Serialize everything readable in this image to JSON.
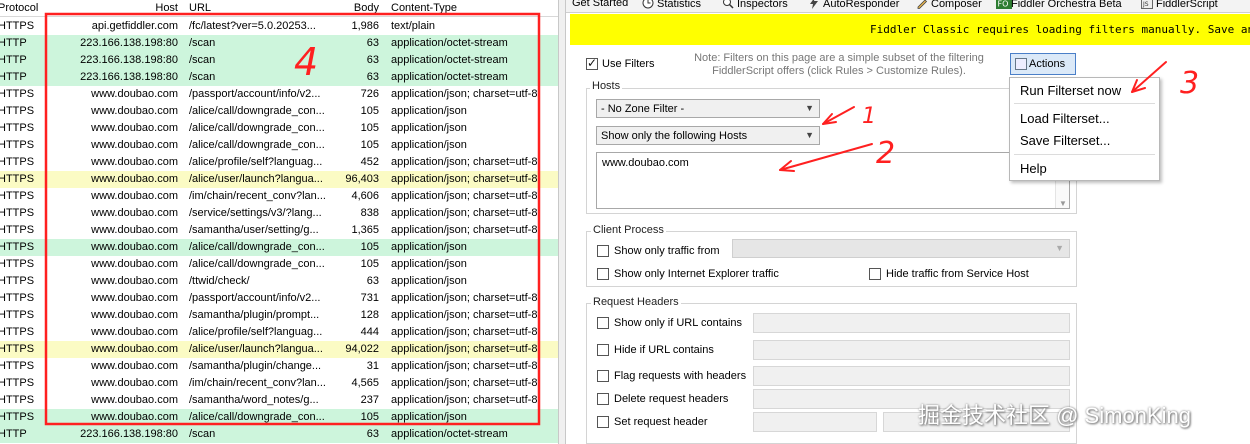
{
  "sessions": {
    "columns": [
      "Protocol",
      "Host",
      "URL",
      "Body",
      "Content-Type"
    ],
    "rows": [
      {
        "protocol": "HTTPS",
        "host": "api.getfiddler.com",
        "url": "/fc/latest?ver=5.0.20253...",
        "body": "1,986",
        "ctype": "text/plain",
        "hl": "white"
      },
      {
        "protocol": "HTTP",
        "host": "223.166.138.198:80",
        "url": "/scan",
        "body": "63",
        "ctype": "application/octet-stream",
        "hl": "green"
      },
      {
        "protocol": "HTTP",
        "host": "223.166.138.198:80",
        "url": "/scan",
        "body": "63",
        "ctype": "application/octet-stream",
        "hl": "green"
      },
      {
        "protocol": "HTTP",
        "host": "223.166.138.198:80",
        "url": "/scan",
        "body": "63",
        "ctype": "application/octet-stream",
        "hl": "green"
      },
      {
        "protocol": "HTTPS",
        "host": "www.doubao.com",
        "url": "/passport/account/info/v2...",
        "body": "726",
        "ctype": "application/json; charset=utf-8",
        "hl": "white"
      },
      {
        "protocol": "HTTPS",
        "host": "www.doubao.com",
        "url": "/alice/call/downgrade_con...",
        "body": "105",
        "ctype": "application/json",
        "hl": "white"
      },
      {
        "protocol": "HTTPS",
        "host": "www.doubao.com",
        "url": "/alice/call/downgrade_con...",
        "body": "105",
        "ctype": "application/json",
        "hl": "white"
      },
      {
        "protocol": "HTTPS",
        "host": "www.doubao.com",
        "url": "/alice/call/downgrade_con...",
        "body": "105",
        "ctype": "application/json",
        "hl": "white"
      },
      {
        "protocol": "HTTPS",
        "host": "www.doubao.com",
        "url": "/alice/profile/self?languag...",
        "body": "452",
        "ctype": "application/json; charset=utf-8",
        "hl": "white"
      },
      {
        "protocol": "HTTPS",
        "host": "www.doubao.com",
        "url": "/alice/user/launch?langua...",
        "body": "96,403",
        "ctype": "application/json; charset=utf-8",
        "hl": "yellow"
      },
      {
        "protocol": "HTTPS",
        "host": "www.doubao.com",
        "url": "/im/chain/recent_conv?lan...",
        "body": "4,606",
        "ctype": "application/json; charset=utf-8",
        "hl": "white"
      },
      {
        "protocol": "HTTPS",
        "host": "www.doubao.com",
        "url": "/service/settings/v3/?lang...",
        "body": "838",
        "ctype": "application/json; charset=utf-8",
        "hl": "white"
      },
      {
        "protocol": "HTTPS",
        "host": "www.doubao.com",
        "url": "/samantha/user/setting/g...",
        "body": "1,365",
        "ctype": "application/json; charset=utf-8",
        "hl": "white"
      },
      {
        "protocol": "HTTPS",
        "host": "www.doubao.com",
        "url": "/alice/call/downgrade_con...",
        "body": "105",
        "ctype": "application/json",
        "hl": "green"
      },
      {
        "protocol": "HTTPS",
        "host": "www.doubao.com",
        "url": "/alice/call/downgrade_con...",
        "body": "105",
        "ctype": "application/json",
        "hl": "white"
      },
      {
        "protocol": "HTTPS",
        "host": "www.doubao.com",
        "url": "/ttwid/check/",
        "body": "63",
        "ctype": "application/json",
        "hl": "white"
      },
      {
        "protocol": "HTTPS",
        "host": "www.doubao.com",
        "url": "/passport/account/info/v2...",
        "body": "731",
        "ctype": "application/json; charset=utf-8",
        "hl": "white"
      },
      {
        "protocol": "HTTPS",
        "host": "www.doubao.com",
        "url": "/samantha/plugin/prompt...",
        "body": "128",
        "ctype": "application/json; charset=utf-8",
        "hl": "white"
      },
      {
        "protocol": "HTTPS",
        "host": "www.doubao.com",
        "url": "/alice/profile/self?languag...",
        "body": "444",
        "ctype": "application/json; charset=utf-8",
        "hl": "white"
      },
      {
        "protocol": "HTTPS",
        "host": "www.doubao.com",
        "url": "/alice/user/launch?langua...",
        "body": "94,022",
        "ctype": "application/json; charset=utf-8",
        "hl": "yellow"
      },
      {
        "protocol": "HTTPS",
        "host": "www.doubao.com",
        "url": "/samantha/plugin/change...",
        "body": "31",
        "ctype": "application/json; charset=utf-8",
        "hl": "white"
      },
      {
        "protocol": "HTTPS",
        "host": "www.doubao.com",
        "url": "/im/chain/recent_conv?lan...",
        "body": "4,565",
        "ctype": "application/json; charset=utf-8",
        "hl": "white"
      },
      {
        "protocol": "HTTPS",
        "host": "www.doubao.com",
        "url": "/samantha/word_notes/g...",
        "body": "237",
        "ctype": "application/json; charset=utf-8",
        "hl": "white"
      },
      {
        "protocol": "HTTPS",
        "host": "www.doubao.com",
        "url": "/alice/call/downgrade_con...",
        "body": "105",
        "ctype": "application/json",
        "hl": "green"
      },
      {
        "protocol": "HTTP",
        "host": "223.166.138.198:80",
        "url": "/scan",
        "body": "63",
        "ctype": "application/octet-stream",
        "hl": "green"
      }
    ]
  },
  "tabs": [
    {
      "label": "Get Started",
      "icon": "none"
    },
    {
      "label": "Statistics",
      "icon": "clock-icon"
    },
    {
      "label": "Inspectors",
      "icon": "magnifier-icon"
    },
    {
      "label": "AutoResponder",
      "icon": "lightning-icon"
    },
    {
      "label": "Composer",
      "icon": "pencil-icon"
    },
    {
      "label": "Fiddler Orchestra Beta",
      "icon": "fo-icon"
    },
    {
      "label": "FiddlerScript",
      "icon": "js-icon"
    }
  ],
  "banner": "Fiddler Classic requires loading filters manually. Save and switch",
  "filters": {
    "use_filters": "Use Filters",
    "note": "Note: Filters on this page are a simple subset of the filtering FiddlerScript offers (click Rules > Customize Rules).",
    "actions_label": "Actions",
    "hosts_title": "Hosts",
    "zone_filter": "- No Zone Filter -",
    "host_mode": "Show only the following Hosts",
    "hosts_text": "www.doubao.com",
    "client_title": "Client Process",
    "show_traffic_from": "Show only traffic from",
    "show_ie": "Show only Internet Explorer traffic",
    "hide_service": "Hide traffic from Service Host",
    "req_title": "Request Headers",
    "show_url": "Show only if URL contains",
    "hide_url": "Hide if URL contains",
    "flag_headers": "Flag requests with headers",
    "delete_headers": "Delete request headers",
    "set_header": "Set request header"
  },
  "menu": {
    "run": "Run Filterset now",
    "load": "Load Filterset...",
    "save": "Save Filterset...",
    "help": "Help"
  },
  "annotations": [
    "1",
    "2",
    "3",
    "4"
  ],
  "watermark": "掘金技术社区 @ SimonKing",
  "colors": {
    "annotation": "#ff2020",
    "highlight_green": "#cdf5dc",
    "highlight_yellow": "#fbfbc4",
    "banner": "#ffff00",
    "menu_border": "#b8b8b8"
  }
}
